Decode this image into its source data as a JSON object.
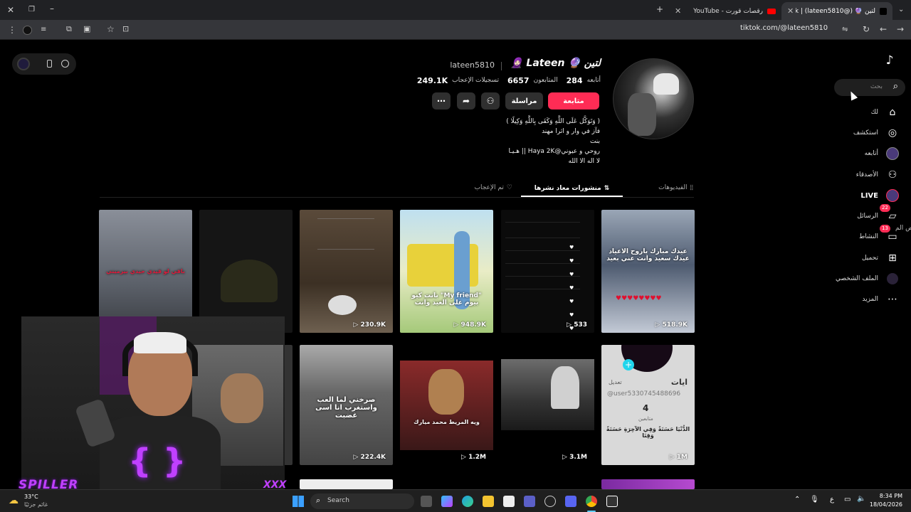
{
  "browser": {
    "tabs": [
      {
        "title": "لتين 🔮 (@lateen5810) | TikTok"
      },
      {
        "title": "رقصات قورت - YouTube"
      }
    ],
    "url": "tiktok.com/@lateen5810"
  },
  "sidebar": {
    "search_placeholder": "بحث",
    "items": [
      {
        "label": "لك",
        "icon": "home-icon"
      },
      {
        "label": "استكشف",
        "icon": "compass-icon"
      },
      {
        "label": "أتابعه",
        "icon": "avatar-icon"
      },
      {
        "label": "الأصدقاء",
        "icon": "friends-icon"
      },
      {
        "label": "LIVE",
        "icon": "live-icon"
      },
      {
        "label": "الرسائل",
        "icon": "messages-icon",
        "badge": "22"
      },
      {
        "label": "النشاط",
        "icon": "activity-icon",
        "badge": "13"
      },
      {
        "label": "تحميل",
        "icon": "upload-icon"
      },
      {
        "label": "الملف الشخصي",
        "icon": "profile-icon"
      },
      {
        "label": "المزيد",
        "icon": "more-icon"
      }
    ],
    "overflow_text": "رض الم"
  },
  "profile": {
    "name": "لتين 🔮 Lateen 🧕🏻",
    "username": "lateen5810",
    "following_count": "284",
    "following_label": "أتابعه",
    "followers_count": "6657",
    "followers_label": "المتابعون",
    "likes_count": "249.1K",
    "likes_label": "تسجيلات الإعجاب",
    "follow_button": "متابعة",
    "message_button": "مراسلة",
    "bio": [
      "( وَتَوَكَّل عَلَى اللَّهِ وَكَفَى بِاللَّهِ وَكِيلًا )",
      "فآز في وار و اثرا مهند",
      "بنت",
      "روحي و عيوني@Haya 2K || هـيـا",
      "لا اله الا الله"
    ]
  },
  "tabs": [
    {
      "label": "الفيديوهات",
      "active": false
    },
    {
      "label": "منشورات معاد نشرها",
      "active": true
    },
    {
      "label": "تم الإعجاب",
      "active": false
    }
  ],
  "videos": [
    {
      "count": "518.9K",
      "caption": "عيدك مبارك ياروح الاعياد عيدك سعيد وانت عني بعيد"
    },
    {
      "count": "533",
      "caption": ""
    },
    {
      "count": "948.9K",
      "caption": "\"My friend\" بانت كيو بيوم على العيد وانت"
    },
    {
      "count": "230.9K",
      "caption": ""
    },
    {
      "count": "",
      "caption": ""
    },
    {
      "count": "",
      "caption": "باقي لو قيدي حيدي بيرميني"
    },
    {
      "count": "1M",
      "caption": "الدُّنْيَا حَسَنَةً وَفِي الآخِرَةِ حَسَنَةً وَقِنَا"
    },
    {
      "count": "3.1M",
      "caption": ""
    },
    {
      "count": "1.2M",
      "caption": "ويه المريط محمد ميارك"
    },
    {
      "count": "222.4K",
      "caption": "صرخني لما العب واستغرب انا اسى غضبت"
    }
  ],
  "profile_card": {
    "name": "ايات",
    "edit": "تعديل",
    "handle": "@user5330745488696",
    "followers_count": "4",
    "followers_label": "متابعين"
  },
  "stream": {
    "streamer": "SPILLER",
    "tag": "XXX"
  },
  "taskbar": {
    "temperature": "33°C",
    "weather": "غائم جزئيًا",
    "search_label": "Search",
    "time": "8:34 PM",
    "date": "18/04/2026",
    "lang": "ع"
  }
}
